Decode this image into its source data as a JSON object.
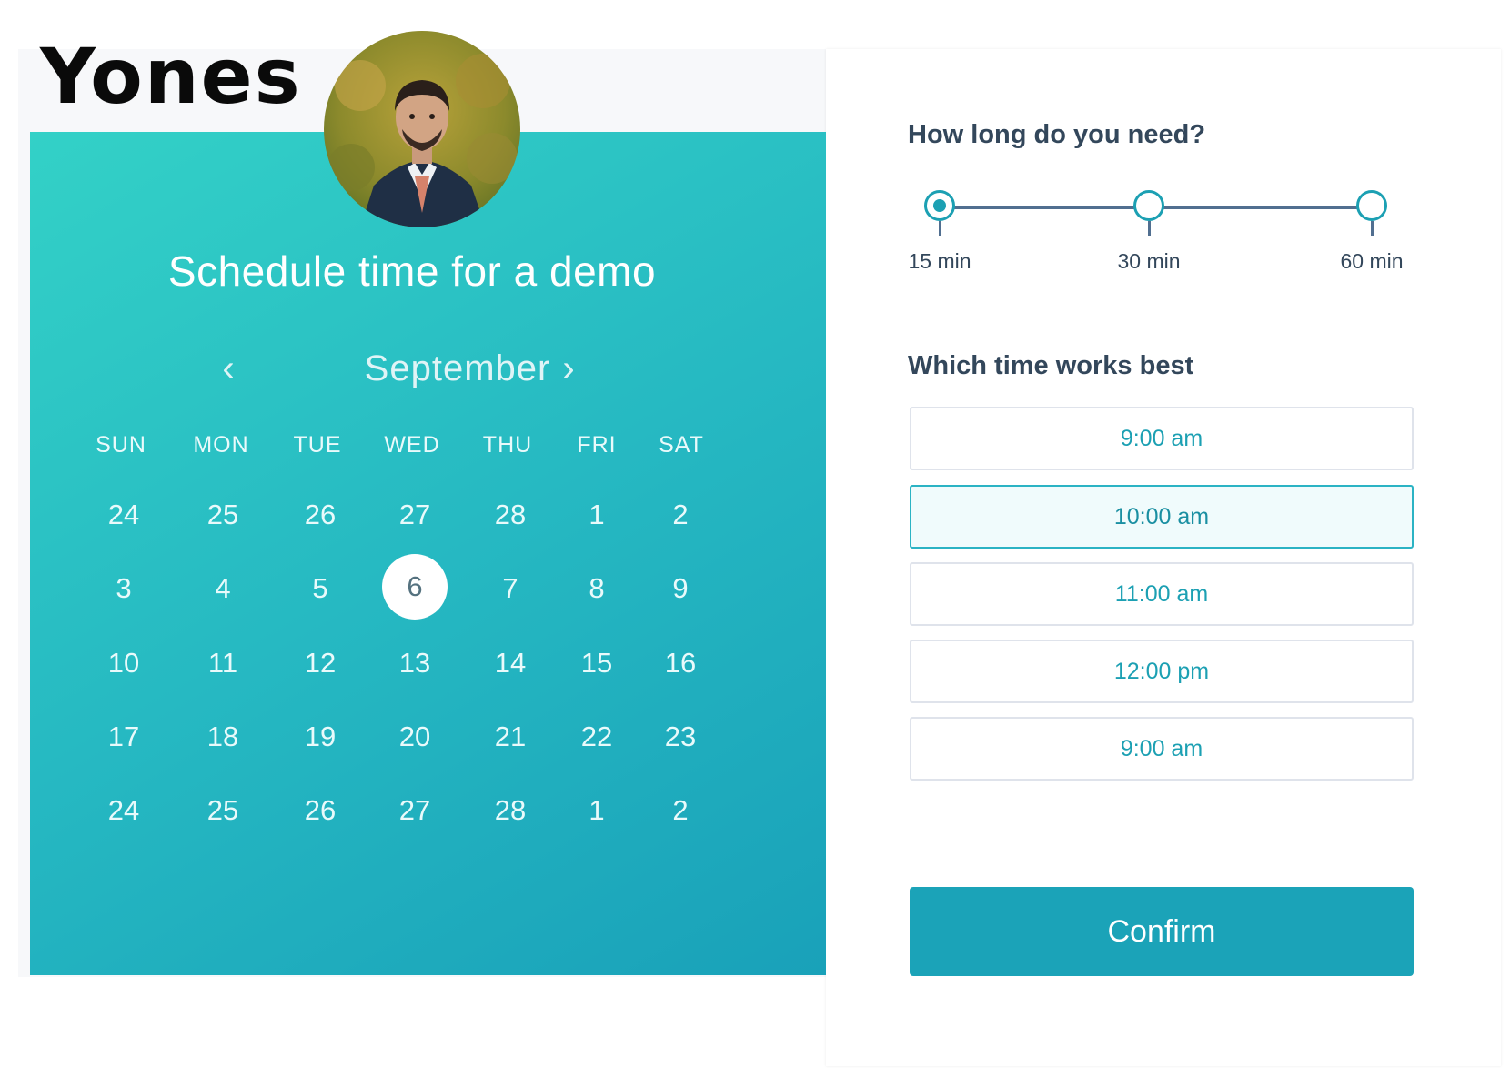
{
  "profile": {
    "name": "Yones"
  },
  "calendar": {
    "title": "Schedule time for a demo",
    "month": "September",
    "prev_icon": "‹",
    "next_icon": "›",
    "weekdays": [
      "SUN",
      "MON",
      "TUE",
      "WED",
      "THU",
      "FRI",
      "SAT"
    ],
    "weeks": [
      [
        "24",
        "25",
        "26",
        "27",
        "28",
        "1",
        "2"
      ],
      [
        "3",
        "4",
        "5",
        "6",
        "7",
        "8",
        "9"
      ],
      [
        "10",
        "11",
        "12",
        "13",
        "14",
        "15",
        "16"
      ],
      [
        "17",
        "18",
        "19",
        "20",
        "21",
        "22",
        "23"
      ],
      [
        "24",
        "25",
        "26",
        "27",
        "28",
        "1",
        "2"
      ]
    ],
    "selected_day": "6"
  },
  "duration": {
    "question": "How long do you need?",
    "options": [
      "15 min",
      "30 min",
      "60 min"
    ],
    "selected": "15 min"
  },
  "times": {
    "question": "Which time works best",
    "slots": [
      "9:00 am",
      "10:00 am",
      "11:00 am",
      "12:00 pm",
      "9:00 am"
    ],
    "selected_index": 1
  },
  "actions": {
    "confirm_label": "Confirm"
  },
  "colors": {
    "accent": "#1ba3b8",
    "calendar_gradient_start": "#33d1c7",
    "calendar_gradient_end": "#19a1b9",
    "label_text": "#33475b"
  },
  "icons": {
    "prev": "chevron-left-icon",
    "next": "chevron-right-icon"
  }
}
